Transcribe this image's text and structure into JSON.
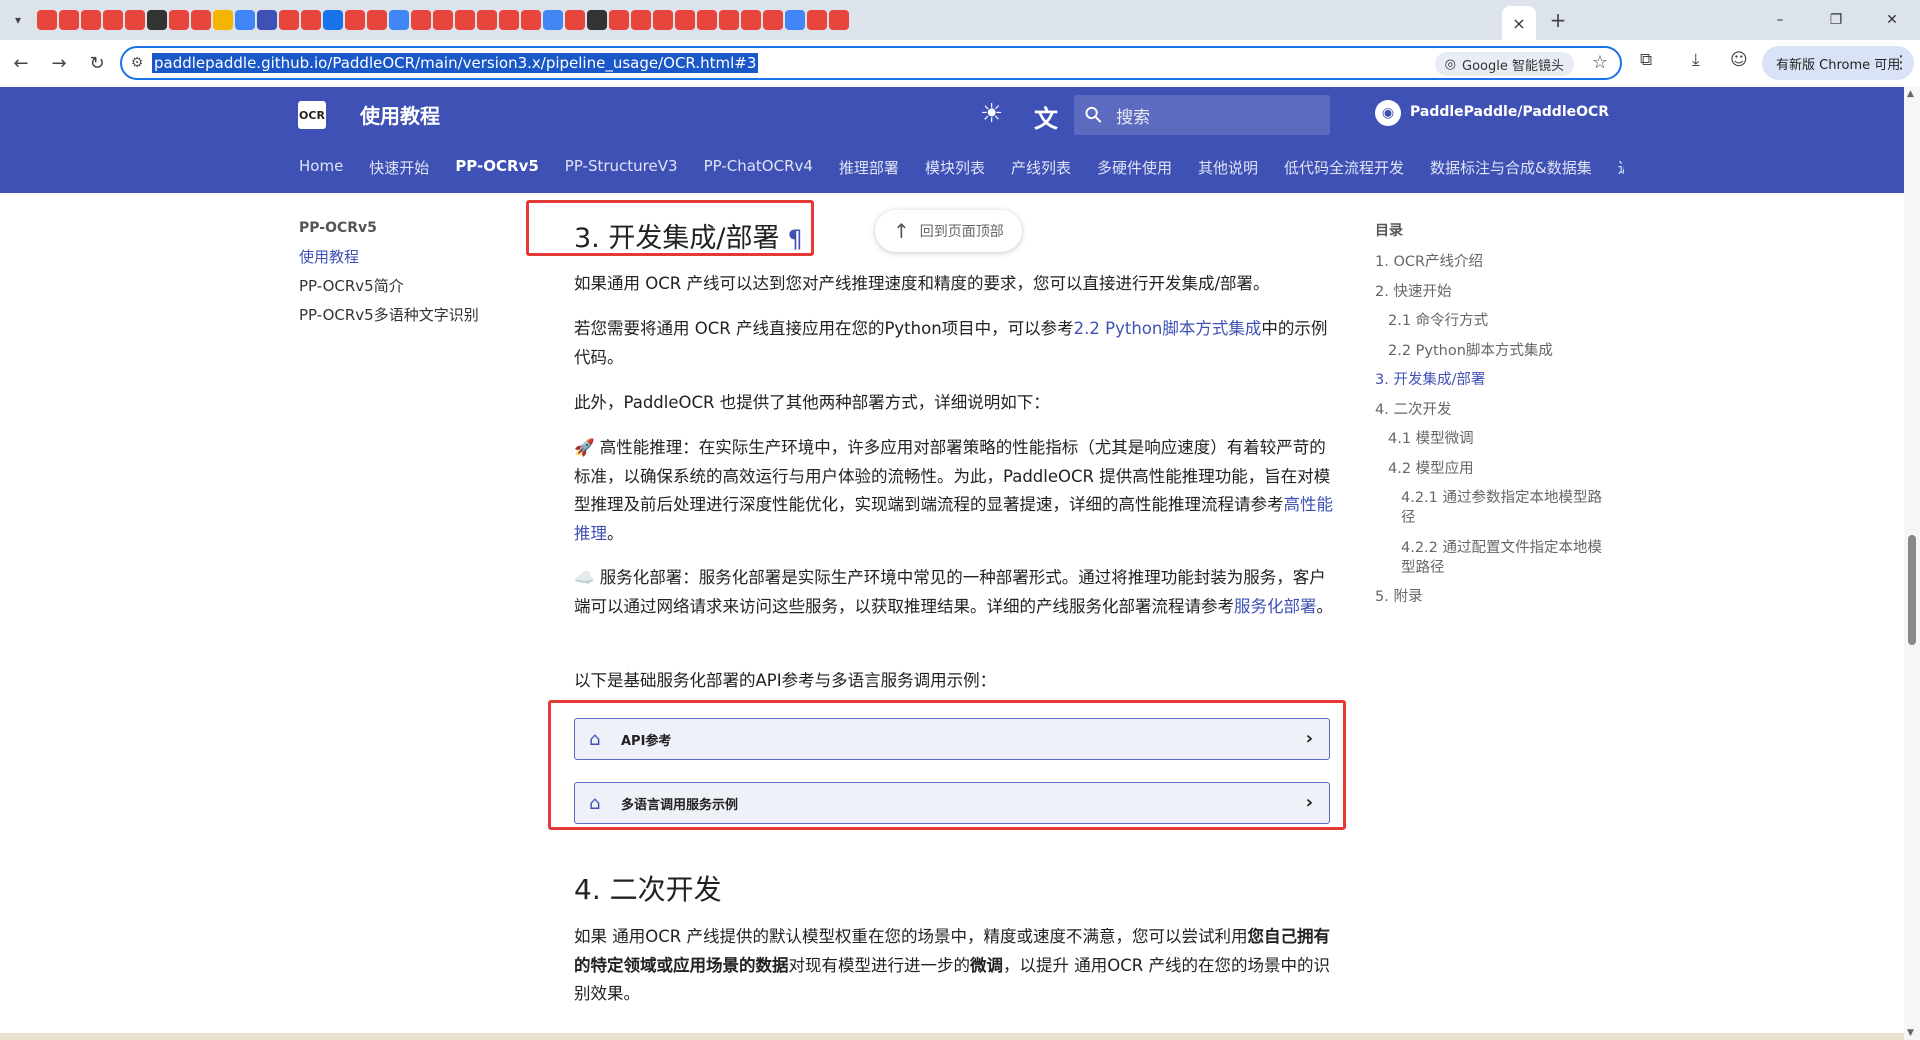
{
  "browser": {
    "tab_menu_icon": "chevron-down-icon",
    "favicon_colors": [
      "#e8453c",
      "#e8453c",
      "#e8453c",
      "#e8453c",
      "#e8453c",
      "#333333",
      "#e8453c",
      "#e8453c",
      "#f4b400",
      "#4285f4",
      "#3f51b5",
      "#e8453c",
      "#e8453c",
      "#1a73e8",
      "#e8453c",
      "#e8453c",
      "#4285f4",
      "#e8453c",
      "#e8453c",
      "#e8453c",
      "#e8453c",
      "#e8453c",
      "#e8453c",
      "#4285f4",
      "#e8453c",
      "#333333",
      "#e8453c",
      "#e8453c",
      "#e8453c",
      "#e8453c",
      "#e8453c",
      "#e8453c",
      "#e8453c",
      "#e8453c",
      "#4285f4",
      "#e8453c",
      "#e8453c"
    ],
    "active_tab_close": "×",
    "new_tab": "+",
    "window_controls": [
      "–",
      "❐",
      "✕"
    ],
    "back": "←",
    "forward": "→",
    "reload": "↻",
    "url": "paddlepaddle.github.io/PaddleOCR/main/version3.x/pipeline_usage/OCR.html#3",
    "lens_label": "Google 智能镜头",
    "star": "☆",
    "update_label": "有新版 Chrome 可用",
    "kebab": "⋮"
  },
  "site": {
    "logo_text": "OCR",
    "title": "使用教程",
    "search_placeholder": "搜索",
    "repo": "PaddlePaddle/PaddleOCR",
    "tabs": [
      "Home",
      "快速开始",
      "PP-OCRv5",
      "PP-StructureV3",
      "PP-ChatOCRv4",
      "推理部署",
      "模块列表",
      "产线列表",
      "多硬件使用",
      "其他说明",
      "低代码全流程开发",
      "数据标注与合成&数据集",
      "近"
    ],
    "active_tab_index": 2
  },
  "left_nav": {
    "title": "PP-OCRv5",
    "items": [
      "使用教程",
      "PP-OCRv5简介",
      "PP-OCRv5多语种文字识别"
    ]
  },
  "content": {
    "back_to_top": "回到页面顶部",
    "h2": "3. 开发集成/部署",
    "pilcrow": "¶",
    "p1": "如果通用 OCR 产线可以达到您对产线推理速度和精度的要求，您可以直接进行开发集成/部署。",
    "p2_a": "若您需要将通用 OCR 产线直接应用在您的Python项目中，可以参考",
    "p2_link": "2.2 Python脚本方式集成",
    "p2_b": "中的示例代码。",
    "p3": "此外，PaddleOCR 也提供了其他两种部署方式，详细说明如下：",
    "p4_icon": "🚀",
    "p4_a": " 高性能推理：在实际生产环境中，许多应用对部署策略的性能指标（尤其是响应速度）有着较严苛的标准，以确保系统的高效运行与用户体验的流畅性。为此，PaddleOCR 提供高性能推理功能，旨在对模型推理及前后处理进行深度性能优化，实现端到端流程的显著提速，详细的高性能推理流程请参考",
    "p4_link": "高性能推理",
    "p4_b": "。",
    "p5_icon": "☁️",
    "p5_a": " 服务化部署：服务化部署是实际生产环境中常见的一种部署形式。通过将推理功能封装为服务，客户端可以通过网络请求来访问这些服务，以获取推理结果。详细的产线服务化部署流程请参考",
    "p5_link": "服务化部署",
    "p5_b": "。",
    "p6": "以下是基础服务化部署的API参考与多语言服务调用示例：",
    "admonitions": [
      "API参考",
      "多语言调用服务示例"
    ],
    "h2b": "4. 二次开发",
    "p7_a": "如果 通用OCR 产线提供的默认模型权重在您的场景中，精度或速度不满意，您可以尝试利用",
    "p7_bold1": "您自己拥有的特定领域或应用场景的数据",
    "p7_b": "对现有模型进行进一步的",
    "p7_bold2": "微调",
    "p7_c": "，以提升 通用OCR 产线的在您的场景中的识别效果。"
  },
  "toc": {
    "title": "目录",
    "items": [
      "1. OCR产线介绍",
      "2. 快速开始",
      "2.1 命令行方式",
      "2.2 Python脚本方式集成",
      "3. 开发集成/部署",
      "4. 二次开发",
      "4.1 模型微调",
      "4.2 模型应用",
      "4.2.1 通过参数指定本地模型路径",
      "4.2.2 通过配置文件指定本地模型路径",
      "5. 附录"
    ]
  }
}
